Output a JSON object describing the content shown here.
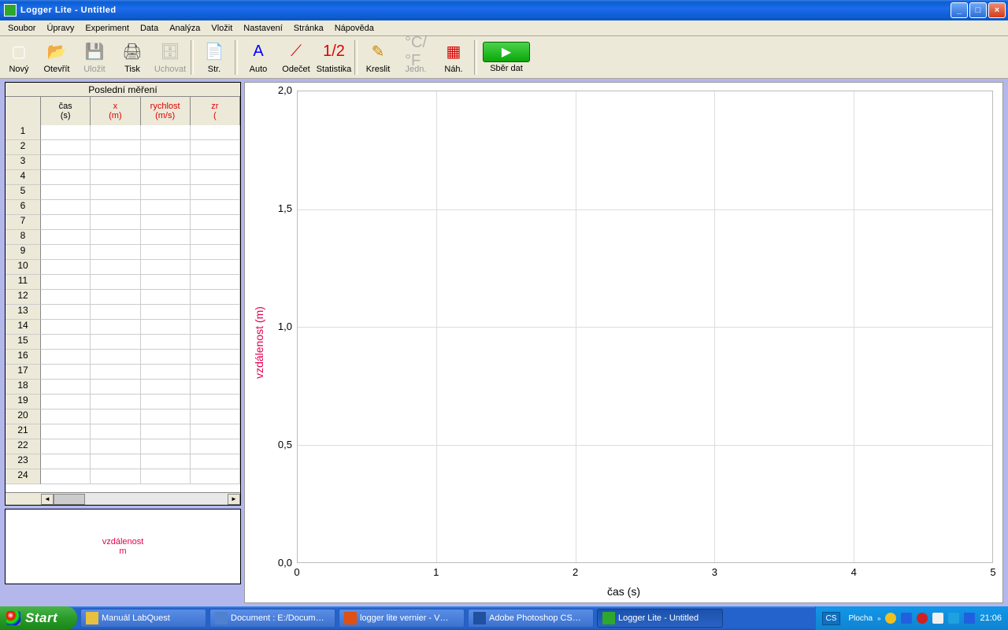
{
  "window": {
    "title": "Logger Lite - Untitled",
    "min": "_",
    "max": "□",
    "close": "×"
  },
  "menus": [
    "Soubor",
    "Úpravy",
    "Experiment",
    "Data",
    "Analýza",
    "Vložit",
    "Nastavení",
    "Stránka",
    "Nápověda"
  ],
  "toolbar_items": [
    {
      "label": "Nový",
      "icon": "file-icon",
      "color": "#fff",
      "glyph": "▢"
    },
    {
      "label": "Otevřít",
      "icon": "open-icon",
      "color": "#e8c040",
      "glyph": "📂"
    },
    {
      "label": "Uložit",
      "icon": "save-icon",
      "color": "#888",
      "glyph": "💾",
      "disabled": true
    },
    {
      "label": "Tisk",
      "icon": "print-icon",
      "color": "#555",
      "glyph": "🖨"
    },
    {
      "label": "Uchovat",
      "icon": "store-icon",
      "color": "#888",
      "glyph": "🗄",
      "disabled": true
    }
  ],
  "toolbar_items2": [
    {
      "label": "Str.",
      "icon": "page-icon",
      "glyph": "📄"
    }
  ],
  "toolbar_items3": [
    {
      "label": "Auto",
      "icon": "autoscale-icon",
      "glyph": "A",
      "color": "#00f"
    },
    {
      "label": "Odečet",
      "icon": "examine-icon",
      "glyph": "⟋",
      "color": "#d00"
    },
    {
      "label": "Statistika",
      "icon": "stats-icon",
      "glyph": "1/2",
      "color": "#d00"
    }
  ],
  "toolbar_items4": [
    {
      "label": "Kreslit",
      "icon": "draw-icon",
      "glyph": "✎",
      "color": "#c80"
    },
    {
      "label": "Jedn.",
      "icon": "units-icon",
      "glyph": "°C/°F",
      "color": "#888",
      "disabled": true
    },
    {
      "label": "Náh.",
      "icon": "preview-icon",
      "glyph": "▦",
      "color": "#d00"
    }
  ],
  "collect_label": "Sběr dat",
  "table": {
    "title": "Poslední měření",
    "cols": [
      {
        "name": "čas",
        "unit": "(s)",
        "red": false
      },
      {
        "name": "x",
        "unit": "(m)",
        "red": true
      },
      {
        "name": "rychlost",
        "unit": "(m/s)",
        "red": true
      },
      {
        "name": "zr",
        "unit": "(",
        "red": true
      }
    ],
    "rows": 24
  },
  "readout": {
    "name": "vzdálenost",
    "unit": "m"
  },
  "chart_data": {
    "type": "line",
    "series": [],
    "xlabel": "čas (s)",
    "ylabel": "vzdálenost (m)",
    "xlim": [
      0,
      5
    ],
    "ylim": [
      0,
      2
    ],
    "xticks": [
      "0",
      "1",
      "2",
      "3",
      "4",
      "5"
    ],
    "yticks": [
      "0,0",
      "0,5",
      "1,0",
      "1,5",
      "2,0"
    ]
  },
  "taskbar": {
    "start": "Start",
    "tasks": [
      {
        "label": "Manuál LabQuest",
        "icon": "folder",
        "color": "#e8c040"
      },
      {
        "label": "Document : E:/Docum…",
        "icon": "doc",
        "color": "#5080d0"
      },
      {
        "label": "logger lite vernier - V…",
        "icon": "ff",
        "color": "#e05010"
      },
      {
        "label": "Adobe Photoshop CS…",
        "icon": "ps",
        "color": "#2050a0"
      },
      {
        "label": "Logger Lite - Untitled",
        "icon": "ll",
        "color": "#2da82d",
        "active": true
      }
    ],
    "lang": "CS",
    "desk": "Plocha",
    "time": "21:06"
  }
}
